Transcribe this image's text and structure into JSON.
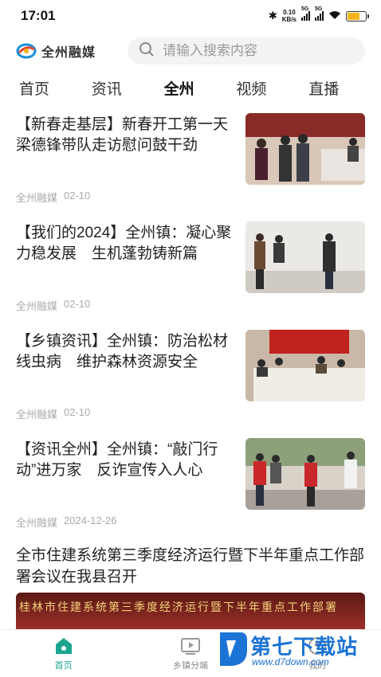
{
  "status_bar": {
    "time": "17:01",
    "net_speed_value": "0.10",
    "net_speed_unit": "KB/s",
    "sig1_label": "5G",
    "sig2_label": "5G"
  },
  "header": {
    "logo_text": "全州融媒",
    "search_placeholder": "请输入搜索内容"
  },
  "tabs": [
    {
      "label": "首页"
    },
    {
      "label": "资讯"
    },
    {
      "label": "全州"
    },
    {
      "label": "视频"
    },
    {
      "label": "直播"
    }
  ],
  "news": [
    {
      "title": "【新春走基层】新春开工第一天 梁德锋带队走访慰问鼓干劲",
      "source": "全州融媒",
      "date": "02-10"
    },
    {
      "title": "【我们的2024】全州镇：凝心聚力稳发展　生机蓬勃铸新篇",
      "source": "全州融媒",
      "date": "02-10"
    },
    {
      "title": "【乡镇资讯】全州镇：防治松材线虫病　维护森林资源安全",
      "source": "全州融媒",
      "date": "02-10"
    },
    {
      "title": "【资讯全州】全州镇：“敲门行动”进万家　反诈宣传入人心",
      "source": "全州融媒",
      "date": "2024-12-26"
    }
  ],
  "featured": {
    "title": "全市住建系统第三季度经济运行暨下半年重点工作部署会议在我县召开",
    "banner_text": "桂林市住建系统第三季度经济运行暨下半年重点工作部署"
  },
  "bottom_nav": [
    {
      "label": "首页"
    },
    {
      "label": "乡镇分端"
    },
    {
      "label": "我的"
    }
  ],
  "watermark": {
    "text": "第七下载站",
    "url": "www.d7down.com"
  },
  "colors": {
    "accent": "#1aa58f",
    "watermark": "#1b73d6"
  }
}
